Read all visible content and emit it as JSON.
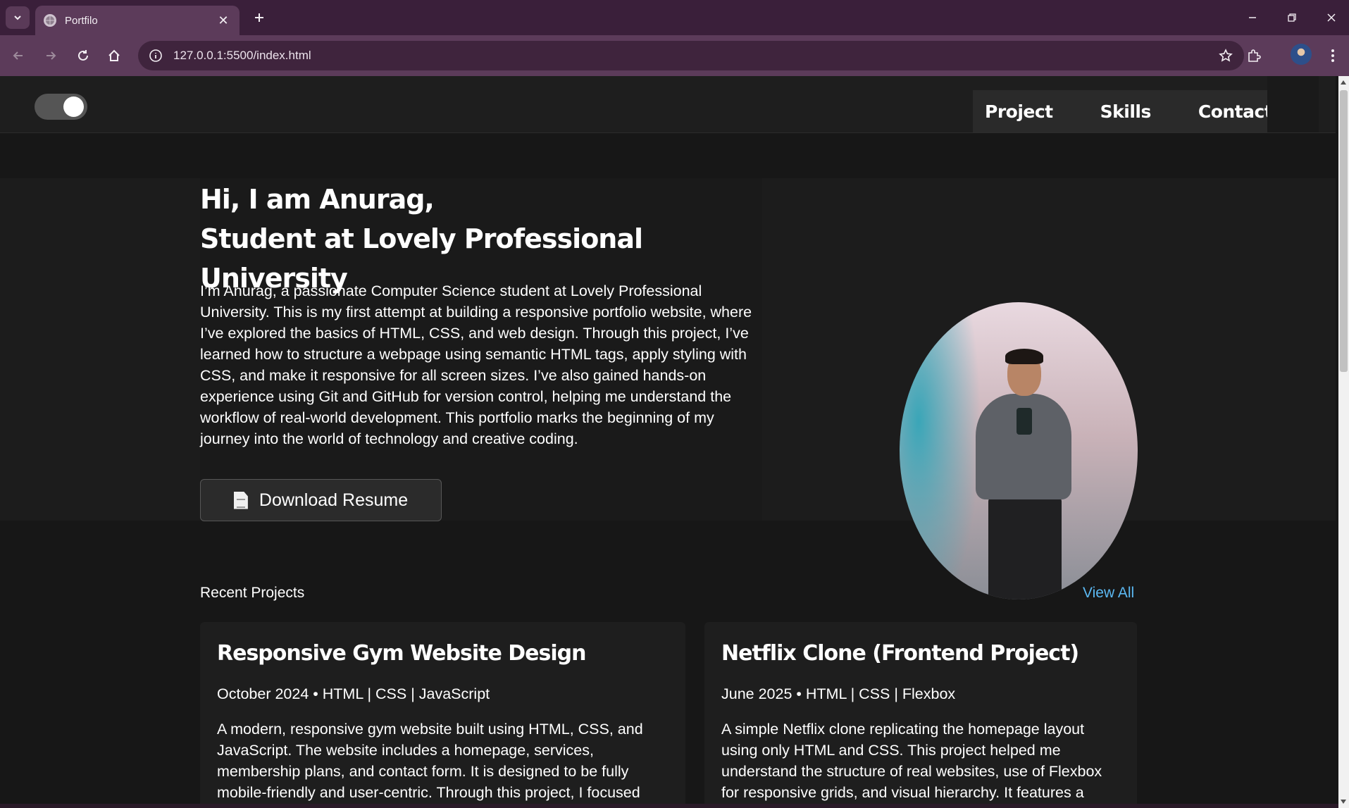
{
  "browser": {
    "tab_title": "Portfilo",
    "tab_close": "✕",
    "new_tab": "+",
    "url": "127.0.0.1:5500/index.html"
  },
  "header": {
    "theme_toggle_state": "on",
    "nav": [
      "Project",
      "Skills",
      "Contact"
    ]
  },
  "hero": {
    "title_line1": "Hi, I am Anurag,",
    "title_line2": "Student at Lovely Professional University",
    "description": "I’m Anurag, a passionate Computer Science student at Lovely Professional University. This is my first attempt at building a responsive portfolio website, where I’ve explored the basics of HTML, CSS, and web design. Through this project, I’ve learned how to structure a webpage using semantic HTML tags, apply styling with CSS, and make it responsive for all screen sizes. I’ve also gained hands-on experience using Git and GitHub for version control, helping me understand the workflow of real-world development. This portfolio marks the beginning of my journey into the world of technology and creative coding.",
    "resume_button": "Download Resume"
  },
  "projects": {
    "heading": "Recent Projects",
    "view_all": "View All",
    "cards": [
      {
        "title": "Responsive Gym Website Design",
        "meta": "October 2024 • HTML | CSS | JavaScript",
        "description": "A modern, responsive gym website built using HTML, CSS, and JavaScript. The website includes a homepage, services, membership plans, and contact form. It is designed to be fully mobile-friendly and user-centric. Through this project, I focused"
      },
      {
        "title": "Netflix Clone (Frontend Project)",
        "meta": "June 2025 • HTML | CSS | Flexbox",
        "description": "A simple Netflix clone replicating the homepage layout using only HTML and CSS. This project helped me understand the structure of real websites, use of Flexbox for responsive grids, and visual hierarchy. It features a"
      }
    ]
  },
  "colors": {
    "tabbar": "#3a1f3a",
    "toolbar": "#5c3b5a",
    "page_bg": "#171717",
    "link": "#5bb8f2"
  }
}
